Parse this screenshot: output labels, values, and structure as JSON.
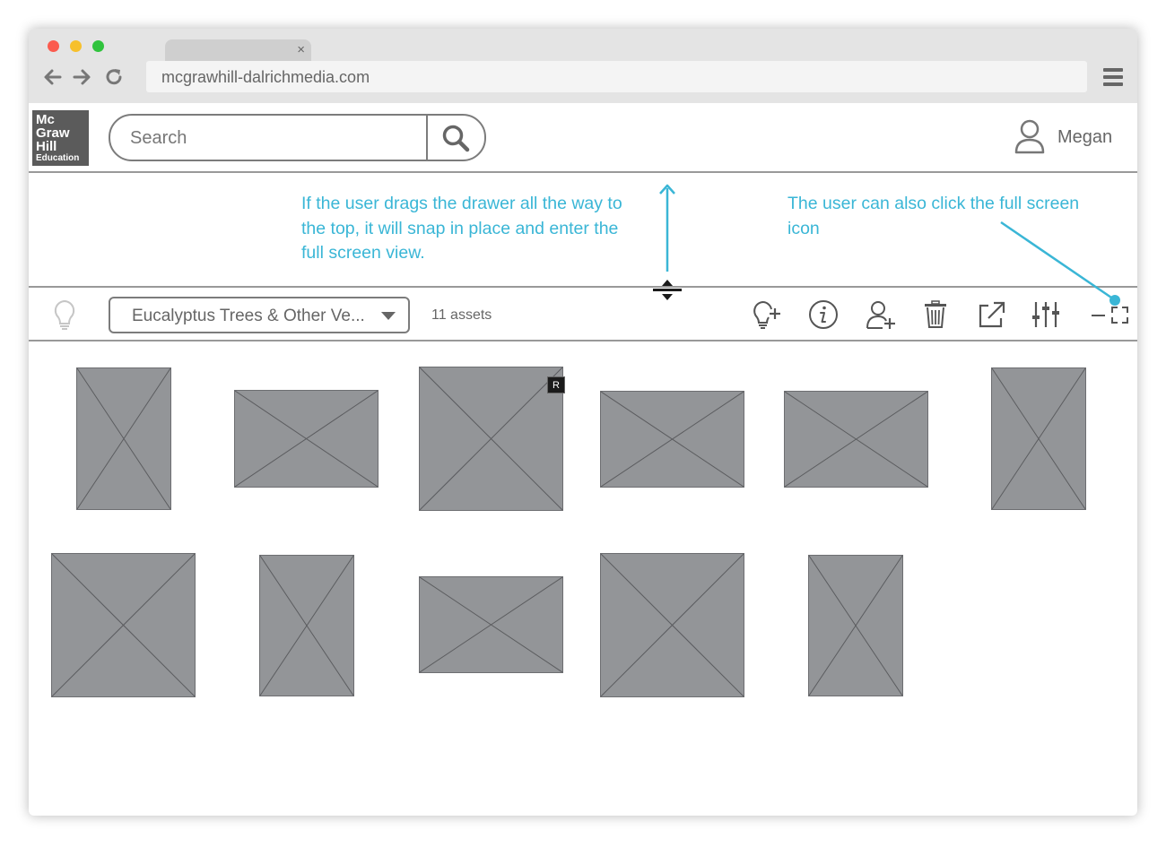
{
  "browser": {
    "url": "mcgrawhill-dalrichmedia.com",
    "tab_close": "×",
    "back_icon": "arrow-left-icon",
    "forward_icon": "arrow-right-icon",
    "reload_icon": "reload-icon",
    "menu_icon": "hamburger-menu-icon"
  },
  "header": {
    "logo": [
      "Mc",
      "Graw",
      "Hill",
      "Education"
    ],
    "search_placeholder": "Search",
    "user_name": "Megan"
  },
  "annotations": {
    "drag_note": "If the user drags the drawer all the way to the top, it will snap in place and enter the full screen view.",
    "fullscreen_note": "The user can also click the full screen icon",
    "color": "#3ab6d6"
  },
  "drawer": {
    "collection_name": "Eucalyptus Trees & Other Ve...",
    "asset_count": "11 assets",
    "tools": [
      "add-idea-icon",
      "info-icon",
      "add-user-icon",
      "trash-icon",
      "share-external-icon",
      "adjust-sliders-icon"
    ]
  },
  "assets": {
    "badge": "R",
    "count": 11,
    "thumbnail_color": "#939598"
  }
}
